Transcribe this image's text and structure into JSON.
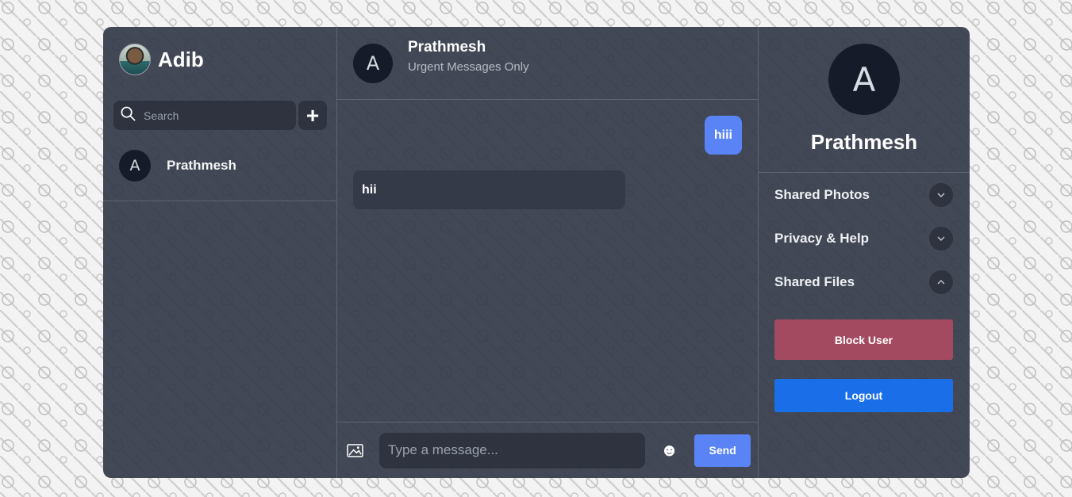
{
  "current_user": {
    "name": "Adib",
    "avatar": "user-photo"
  },
  "search": {
    "placeholder": "Search",
    "add_label": "+"
  },
  "contacts": [
    {
      "initial": "A",
      "name": "Prathmesh"
    }
  ],
  "chat": {
    "header": {
      "initial": "A",
      "name": "Prathmesh",
      "status": "Urgent Messages Only"
    },
    "messages": [
      {
        "direction": "outgoing",
        "text": "hiii"
      },
      {
        "direction": "incoming",
        "text": "hii"
      }
    ],
    "composer": {
      "placeholder": "Type a message...",
      "send_label": "Send",
      "emoji": "☻",
      "image_icon": "image-icon"
    }
  },
  "details": {
    "initial": "A",
    "name": "Prathmesh",
    "sections": [
      {
        "label": "Shared Photos",
        "icon": "chevron-down-icon"
      },
      {
        "label": "Privacy & Help",
        "icon": "chevron-down-icon"
      },
      {
        "label": "Shared Files",
        "icon": "chevron-up-icon"
      }
    ],
    "block_label": "Block User",
    "logout_label": "Logout"
  },
  "colors": {
    "panel": "#343a48",
    "accent": "#5a84f6",
    "danger": "#a34a61",
    "logout": "#1a6fe8",
    "avatar_bg": "#151b29"
  }
}
